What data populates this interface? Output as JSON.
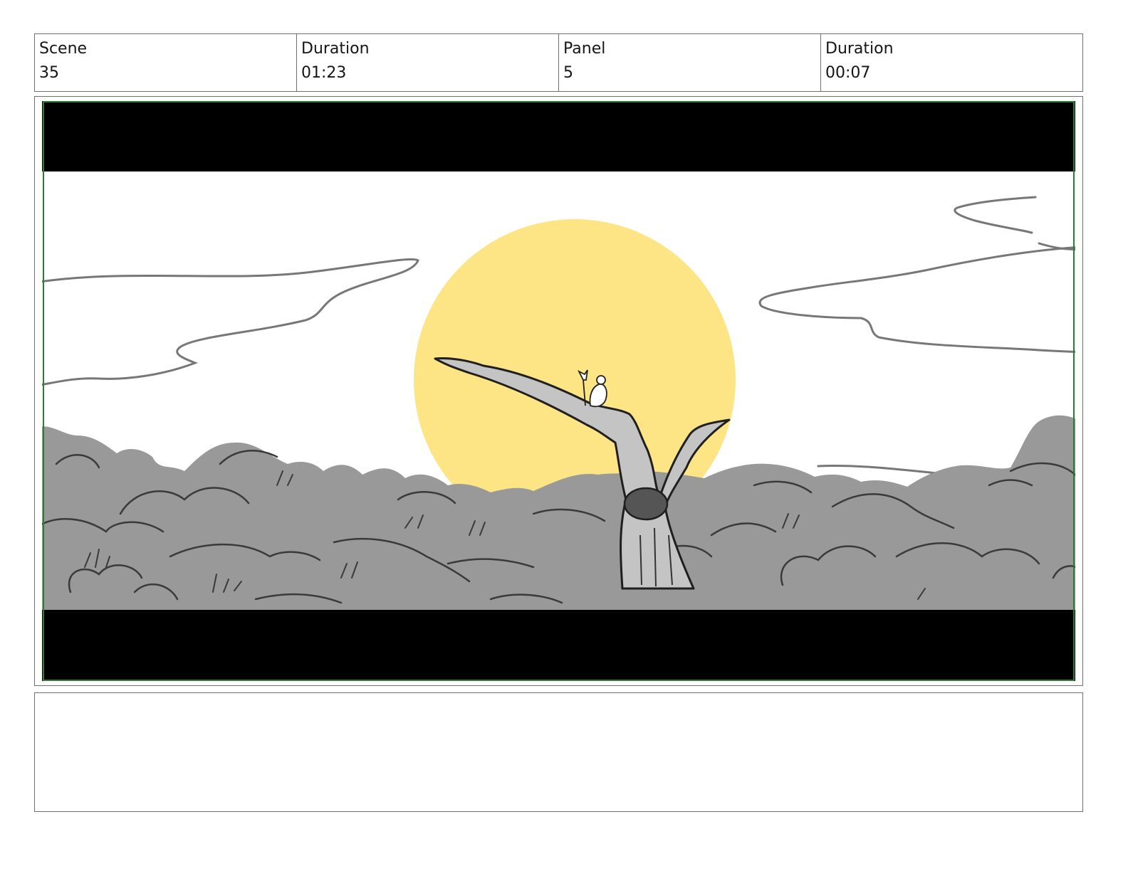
{
  "header": {
    "scene_label": "Scene",
    "scene_value": "35",
    "scene_duration_label": "Duration",
    "scene_duration_value": "01:23",
    "panel_label": "Panel",
    "panel_value": "5",
    "panel_duration_label": "Duration",
    "panel_duration_value": "00:07"
  },
  "panel": {
    "frame_border_color": "#2e7d32",
    "letterbox_color": "#000000",
    "sun_color": "#fde484",
    "foliage_color": "#999999",
    "tree_color": "#c4c4c4",
    "cloud_line_color": "#777777"
  },
  "notes": {
    "text": ""
  }
}
